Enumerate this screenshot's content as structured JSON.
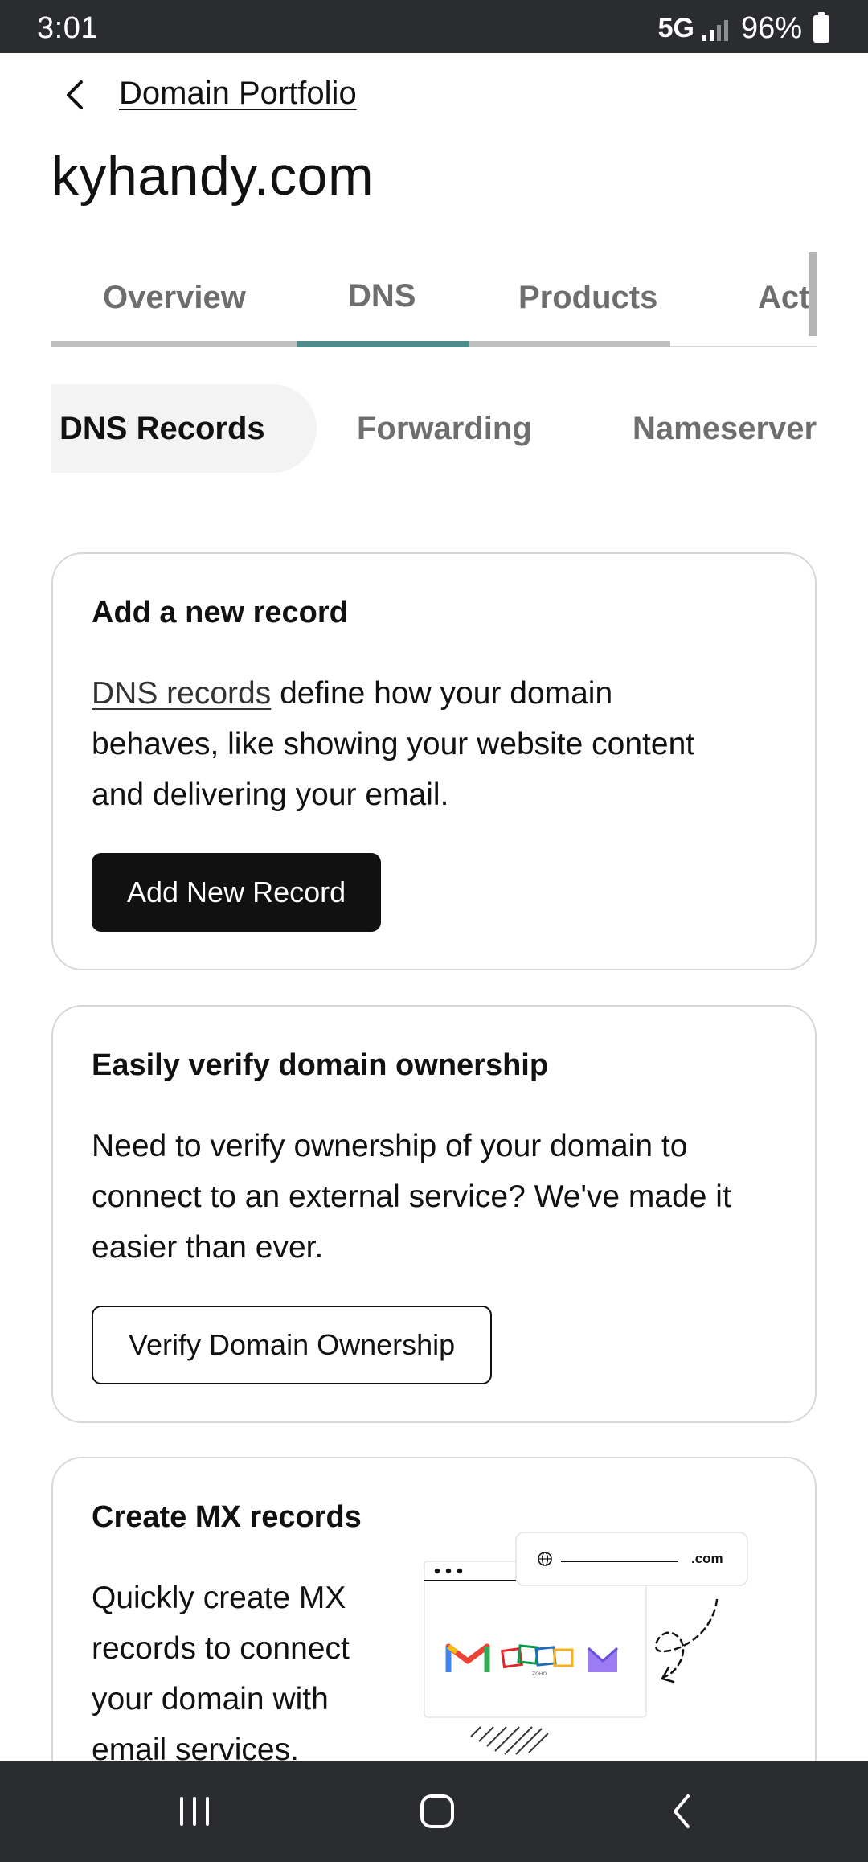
{
  "status_bar": {
    "time": "3:01",
    "network": "5G",
    "battery": "96%"
  },
  "header": {
    "breadcrumb": "Domain Portfolio",
    "title": "kyhandy.com"
  },
  "tabs": [
    {
      "label": "Overview"
    },
    {
      "label": "DNS"
    },
    {
      "label": "Products"
    },
    {
      "label": "Activity"
    }
  ],
  "subtabs": [
    {
      "label": "DNS Records"
    },
    {
      "label": "Forwarding"
    },
    {
      "label": "Nameservers"
    }
  ],
  "cards": {
    "add_record": {
      "title": "Add a new record",
      "link": "DNS records",
      "body_line1_rest": " define how your domain",
      "body_line2": "behaves, like showing your website content",
      "body_line3": "and delivering your email.",
      "button": "Add New Record"
    },
    "verify": {
      "title": "Easily verify domain ownership",
      "body_line1": "Need to verify ownership of your domain to",
      "body_line2": "connect to an external service? We've made it",
      "body_line3": "easier than ever.",
      "button": "Verify Domain Ownership"
    },
    "mx": {
      "title": "Create MX records",
      "body_line1": "Quickly create MX",
      "body_line2": "records to connect",
      "body_line3": "your domain with",
      "body_line4": "email services.",
      "illustration_domain": ".com",
      "illustration_brand": "ZOHO"
    }
  },
  "colors": {
    "tab_indicator": "#4d8a8a",
    "system_bar": "#2b2c30",
    "primary_button": "#111111"
  }
}
